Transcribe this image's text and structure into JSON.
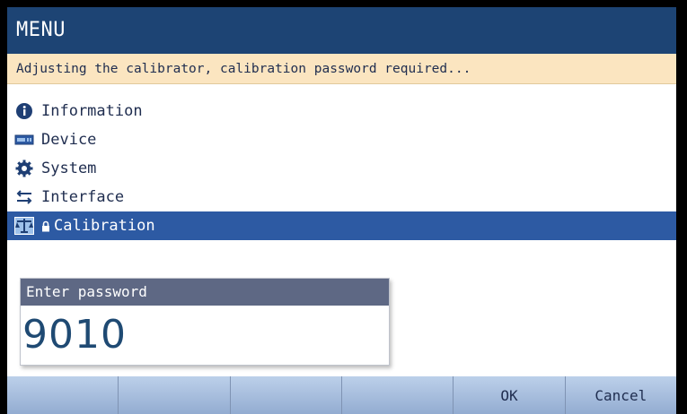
{
  "title": "MENU",
  "message": "Adjusting the calibrator, calibration password required...",
  "menu": {
    "items": [
      {
        "label": "Information",
        "icon": "info-icon"
      },
      {
        "label": "Device",
        "icon": "device-icon"
      },
      {
        "label": "System",
        "icon": "gear-icon"
      },
      {
        "label": "Interface",
        "icon": "interface-arrows-icon"
      },
      {
        "label": "Calibration",
        "icon": "calibration-icon",
        "locked": true,
        "selected": true
      }
    ]
  },
  "password": {
    "label": "Enter password",
    "value": "9010"
  },
  "softkeys": [
    "",
    "",
    "",
    "",
    "OK",
    "Cancel"
  ],
  "colors": {
    "title_bg": "#1d4474",
    "message_bg": "#fbe5c0",
    "selected_bg": "#2d5aa3",
    "softkey_bg": "#a8bddc"
  }
}
